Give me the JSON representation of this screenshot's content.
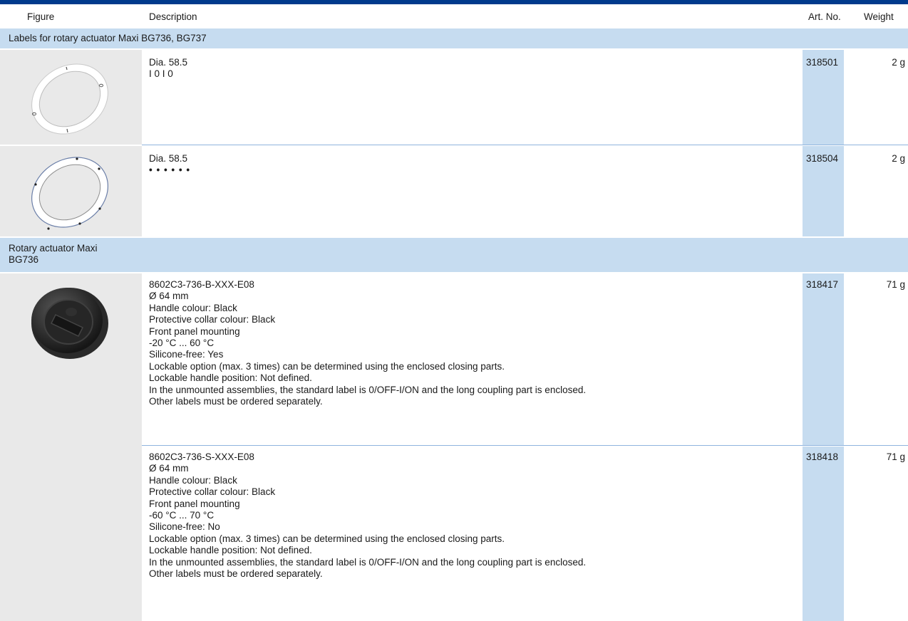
{
  "header": {
    "figure": "Figure",
    "description": "Description",
    "art_no": "Art. No.",
    "weight": "Weight"
  },
  "section1": {
    "title": "Labels for rotary actuator Maxi BG736, BG737"
  },
  "section2": {
    "title_line1": "Rotary actuator Maxi",
    "title_line2": "BG736"
  },
  "rows": [
    {
      "lines": [
        "Dia. 58.5",
        "I  0  I  0"
      ],
      "art_no": "318501",
      "weight": "2 g"
    },
    {
      "lines": [
        "Dia. 58.5",
        "• • • • • •"
      ],
      "art_no": "318504",
      "weight": "2 g"
    },
    {
      "lines": [
        "8602C3-736-B-XXX-E08",
        "Ø 64 mm",
        "Handle colour: Black",
        "Protective collar colour: Black",
        "Front panel mounting",
        "-20 °C ... 60 °C",
        "Silicone-free: Yes",
        "Lockable option (max. 3 times) can be determined using the enclosed closing parts.",
        "Lockable handle position: Not defined.",
        "In the unmounted assemblies, the standard label is 0/OFF-I/ON and the long coupling part is enclosed.",
        "Other labels must be ordered separately."
      ],
      "art_no": "318417",
      "weight": "71 g"
    },
    {
      "lines": [
        "8602C3-736-S-XXX-E08",
        "Ø 64 mm",
        "Handle colour: Black",
        "Protective collar colour: Black",
        "Front panel mounting",
        "-60 °C ... 70 °C",
        "Silicone-free: No",
        "Lockable option (max. 3 times) can be determined using the enclosed closing parts.",
        "Lockable handle position: Not defined.",
        "In the unmounted assemblies, the standard label is 0/OFF-I/ON and the long coupling part is enclosed.",
        "Other labels must be ordered separately."
      ],
      "art_no": "318418",
      "weight": "71 g"
    }
  ]
}
